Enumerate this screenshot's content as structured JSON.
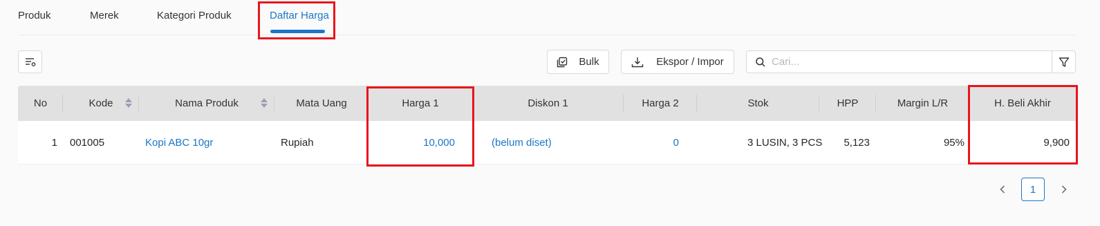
{
  "tabs": [
    {
      "label": "Produk"
    },
    {
      "label": "Merek"
    },
    {
      "label": "Kategori Produk"
    },
    {
      "label": "Daftar Harga",
      "active": true
    }
  ],
  "toolbar": {
    "bulk_label": "Bulk",
    "export_import_label": "Ekspor / Impor",
    "search_placeholder": "Cari..."
  },
  "table": {
    "columns": [
      "No",
      "Kode",
      "Nama Produk",
      "Mata Uang",
      "Harga 1",
      "Diskon 1",
      "Harga 2",
      "Stok",
      "HPP",
      "Margin L/R",
      "H. Beli Akhir"
    ],
    "rows": [
      {
        "no": "1",
        "kode": "001005",
        "nama_produk": "Kopi ABC 10gr",
        "mata_uang": "Rupiah",
        "harga_1": "10,000",
        "diskon_1": "(belum diset)",
        "harga_2": "0",
        "stok": "3 LUSIN, 3 PCS",
        "hpp": "5,123",
        "margin": "95%",
        "h_beli_akhir": "9,900"
      }
    ]
  },
  "pagination": {
    "current_page": "1",
    "prev_icon": "chevron-left-icon",
    "next_icon": "chevron-right-icon"
  },
  "colors": {
    "accent": "#1b76c8",
    "highlight": "#e8141b",
    "header_bg": "#e1e1e1"
  }
}
